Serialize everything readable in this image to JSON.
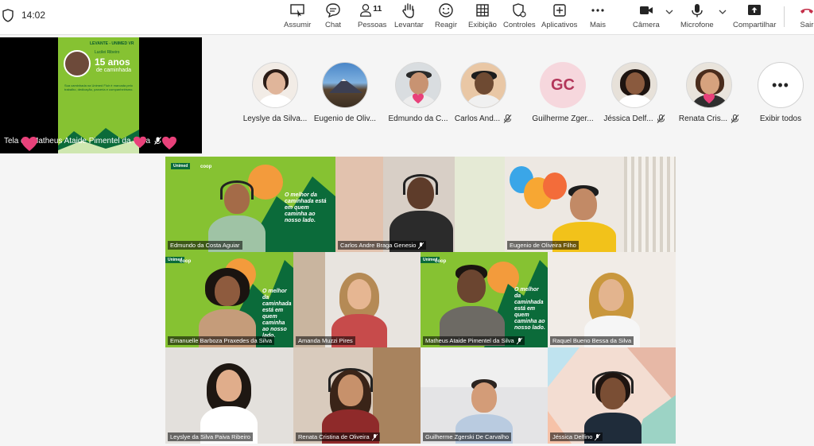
{
  "status": {
    "time": "14:02"
  },
  "toolbar": {
    "assumir": "Assumir",
    "chat": "Chat",
    "pessoas": "Pessoas",
    "pessoas_count": "11",
    "levantar": "Levantar",
    "reagir": "Reagir",
    "exibicao": "Exibição",
    "controles": "Controles",
    "aplicativos": "Aplicativos",
    "mais": "Mais",
    "camera": "Câmera",
    "microfone": "Microfone",
    "compartilhar": "Compartilhar",
    "sair": "Sair"
  },
  "share": {
    "label": "Tela de Matheus Ataide Pimentel da Silva",
    "poster_top": "LEVANTE - UNIMED VR",
    "poster_name": "Lucilei Ribeiro",
    "poster_big": "15 anos",
    "poster_sub": "de caminhada",
    "poster_text": "Sua caminhada na Unimed Fluir é marcada pelo trabalho, dedicação, parceria e companheirismo."
  },
  "strip": {
    "p1": "Leyslye da Silva...",
    "p2": "Eugenio de Oliv...",
    "p3": "Edmundo da C...",
    "p4": "Carlos And...",
    "p5_initials": "GC",
    "p5": "Guilherme Zger...",
    "p6": "Jéssica Delf...",
    "p7": "Renata Cris...",
    "view_all": "Exibir todos"
  },
  "tiles": {
    "t1": "Edmundo da Costa Aguiar",
    "t2": "Carlos Andre Braga Genesio",
    "t3": "Eugenio de Oliveira Filho",
    "t4": "Emanuelle Barboza Praxedes da Silva",
    "t5": "Amanda Muzzi Pires",
    "t6": "Matheus Ataide Pimentel da Silva",
    "t7": "Raquel Bueno Bessa da Silva",
    "t8": "Leyslye da Silva Paiva Ribeiro",
    "t9": "Renata Cristina de  Oliveira",
    "t10": "Guilherme Zgerski De Carvalho",
    "t11": "Jéssica Delfino"
  },
  "background": {
    "slogan": "O melhor da caminhada está em quem caminha ao nosso lado.",
    "logo": "Unimed",
    "coop": "coop"
  },
  "colors": {
    "accent": "#86c232",
    "dark_green": "#0b6b3a",
    "heart": "#e8417a"
  }
}
